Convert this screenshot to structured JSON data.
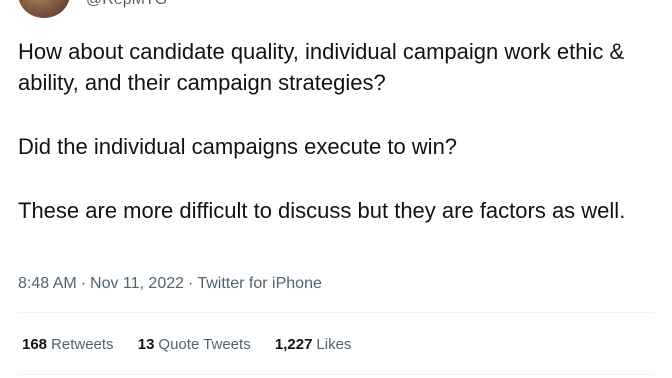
{
  "author": {
    "handle": "@RepMTG"
  },
  "tweet": {
    "paragraphs": [
      "How about candidate quality, individual campaign work ethic & ability, and their campaign strategies?",
      "Did the individual campaigns execute to win?",
      "These are more difficult to discuss but they are factors as well."
    ],
    "time": "8:48 AM",
    "date": "Nov 11, 2022",
    "source": "Twitter for iPhone",
    "separator": "·"
  },
  "stats": {
    "retweets": {
      "count": "168",
      "label": "Retweets"
    },
    "quote_tweets": {
      "count": "13",
      "label": "Quote Tweets"
    },
    "likes": {
      "count": "1,227",
      "label": "Likes"
    }
  }
}
